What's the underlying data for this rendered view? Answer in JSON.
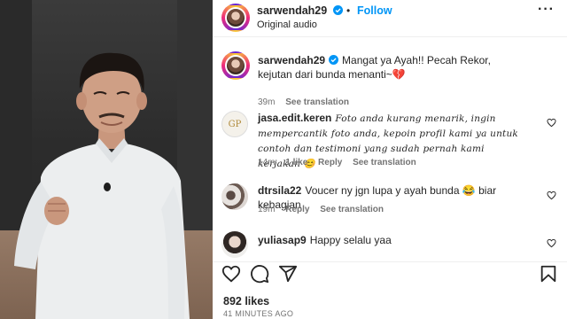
{
  "post": {
    "username": "sarwendah29",
    "follow_label": "Follow",
    "dot": "•",
    "audio": "Original audio",
    "more_icon": "more-horizontal-icon"
  },
  "caption": {
    "username": "sarwendah29",
    "text": "Mangat ya Ayah!! Pecah Rekor, kejutan dari bunda menanti~💔",
    "time": "39m",
    "see_translation": "See translation"
  },
  "comments": [
    {
      "username": "jasa.edit.keren",
      "text": "Foto anda kurang menarik, ingin mempercantik foto anda, kepoin profil kami ya untuk contoh dan testimoni yang sudah pernah kami kerjakan 😊",
      "time": "14m",
      "likes": "1 like",
      "reply": "Reply",
      "see_translation": "See translation",
      "avatar_label": "GP"
    },
    {
      "username": "dtrsila22",
      "text": "Voucer ny jgn lupa y ayah bunda 😂 biar kebagian",
      "time": "19m",
      "reply": "Reply",
      "see_translation": "See translation"
    },
    {
      "username": "yuliasap9",
      "text": "Happy selalu yaa"
    }
  ],
  "footer": {
    "likes": "892 likes",
    "ago": "41 MINUTES AGO"
  },
  "colors": {
    "link": "#0095f6",
    "muted": "#737373",
    "text": "#262626",
    "verified": "#0095f6"
  },
  "icons": [
    "heart-icon",
    "comment-icon",
    "share-icon",
    "bookmark-icon",
    "verified-badge-icon"
  ]
}
